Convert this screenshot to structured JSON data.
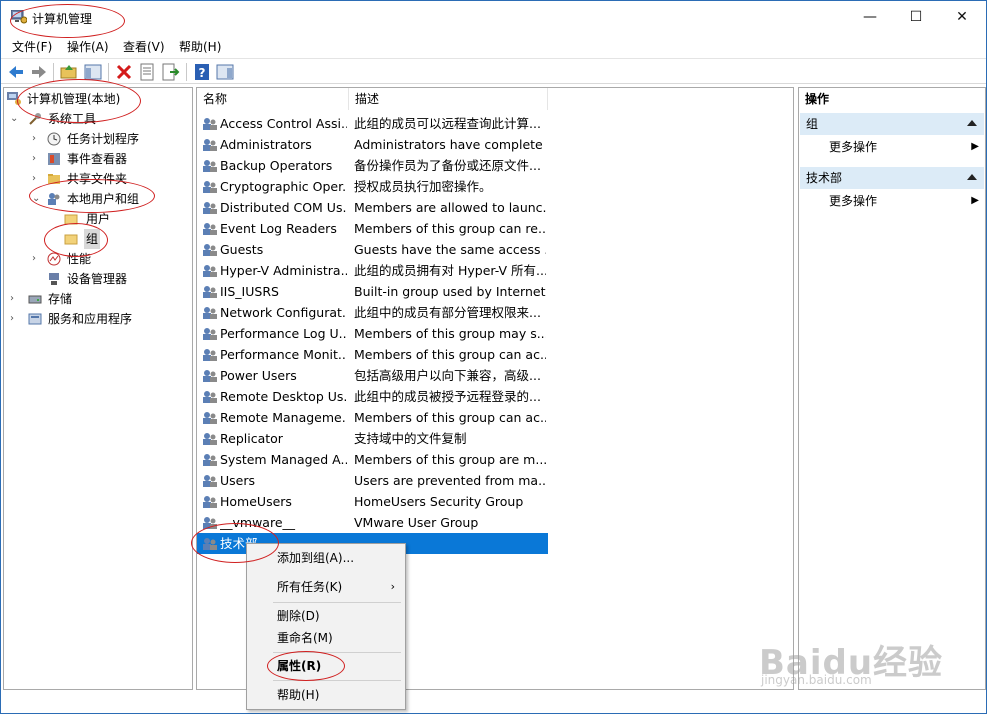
{
  "window": {
    "title": "计算机管理"
  },
  "menubar": [
    "文件(F)",
    "操作(A)",
    "查看(V)",
    "帮助(H)"
  ],
  "toolbar": [
    "back-icon",
    "forward-icon",
    "up-folder-icon",
    "show-tree-icon",
    "delete-icon",
    "properties-icon",
    "export-icon",
    "help-icon",
    "action-pane-icon"
  ],
  "tree": {
    "root": "计算机管理(本地)",
    "system_tools": "系统工具",
    "task_scheduler": "任务计划程序",
    "event_viewer": "事件查看器",
    "shared_folders": "共享文件夹",
    "local_users_groups": "本地用户和组",
    "users": "用户",
    "groups": "组",
    "performance": "性能",
    "device_manager": "设备管理器",
    "storage": "存储",
    "services_apps": "服务和应用程序"
  },
  "list": {
    "columns": {
      "name": "名称",
      "description": "描述"
    },
    "rows": [
      {
        "name": "Access Control Assi...",
        "desc": "此组的成员可以远程查询此计算..."
      },
      {
        "name": "Administrators",
        "desc": "Administrators have complete ..."
      },
      {
        "name": "Backup Operators",
        "desc": "备份操作员为了备份或还原文件..."
      },
      {
        "name": "Cryptographic Oper...",
        "desc": "授权成员执行加密操作。"
      },
      {
        "name": "Distributed COM Us...",
        "desc": "Members are allowed to launc..."
      },
      {
        "name": "Event Log Readers",
        "desc": "Members of this group can re..."
      },
      {
        "name": "Guests",
        "desc": "Guests have the same access ..."
      },
      {
        "name": "Hyper-V Administra...",
        "desc": "此组的成员拥有对 Hyper-V 所有..."
      },
      {
        "name": "IIS_IUSRS",
        "desc": "Built-in group used by Internet..."
      },
      {
        "name": "Network Configurat...",
        "desc": "此组中的成员有部分管理权限来..."
      },
      {
        "name": "Performance Log U...",
        "desc": "Members of this group may s..."
      },
      {
        "name": "Performance Monit...",
        "desc": "Members of this group can ac..."
      },
      {
        "name": "Power Users",
        "desc": "包括高级用户以向下兼容，高级..."
      },
      {
        "name": "Remote Desktop Us...",
        "desc": "此组中的成员被授予远程登录的..."
      },
      {
        "name": "Remote Manageme...",
        "desc": "Members of this group can ac..."
      },
      {
        "name": "Replicator",
        "desc": "支持域中的文件复制"
      },
      {
        "name": "System Managed A...",
        "desc": "Members of this group are m..."
      },
      {
        "name": "Users",
        "desc": "Users are prevented from ma..."
      },
      {
        "name": "HomeUsers",
        "desc": "HomeUsers Security Group"
      },
      {
        "name": "__vmware__",
        "desc": "VMware User Group"
      },
      {
        "name": "技术部",
        "desc": ""
      }
    ]
  },
  "context_menu": {
    "add_to_group": "添加到组(A)...",
    "all_tasks": "所有任务(K)",
    "delete": "删除(D)",
    "rename": "重命名(M)",
    "properties": "属性(R)",
    "help": "帮助(H)"
  },
  "actions": {
    "title": "操作",
    "group1": "组",
    "more1": "更多操作",
    "group2": "技术部",
    "more2": "更多操作"
  },
  "watermark": {
    "main": "Baidu经验",
    "sub": "jingyan.baidu.com"
  },
  "colors": {
    "selection": "#0a78d7",
    "annotation": "#d02020",
    "action_header": "#dcebf7"
  }
}
